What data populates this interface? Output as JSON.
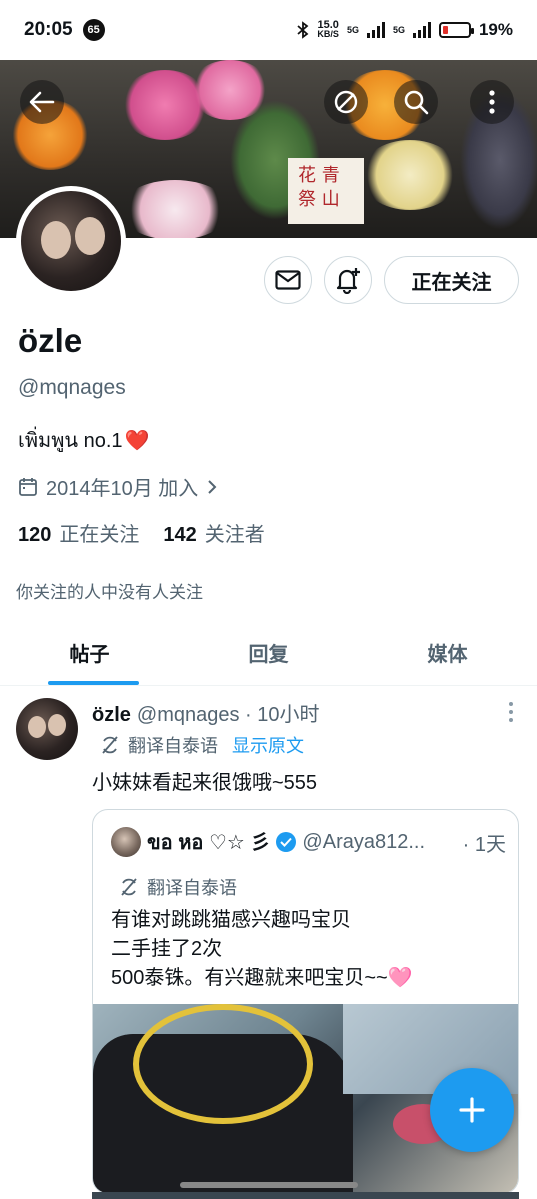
{
  "status_bar": {
    "time": "20:05",
    "notif_count": "65",
    "net_speed_value": "15.0",
    "net_speed_unit": "KB/S",
    "sim1": "5G",
    "sim2": "5G",
    "battery_percent": "19%",
    "battery_level": 0.19
  },
  "profile": {
    "display_name": "özle",
    "handle": "@mqnages",
    "bio": "เพิ่มพูน no.1",
    "bio_emoji": "❤️",
    "joined": "2014年10月 加入",
    "following_count": "120",
    "following_label": "正在关注",
    "followers_count": "142",
    "followers_label": "关注者",
    "mutual_note": "你关注的人中没有人关注",
    "follow_button": "正在关注"
  },
  "banner_sign": {
    "line1": "花 青",
    "line2": "祭 山"
  },
  "tabs": [
    {
      "label": "帖子",
      "active": true
    },
    {
      "label": "回复",
      "active": false
    },
    {
      "label": "媒体",
      "active": false
    }
  ],
  "post": {
    "name": "özle",
    "meta": "@mqnages · 10小时",
    "translate_label": "翻译自泰语",
    "show_original": "显示原文",
    "text": "小妹妹看起来很饿哦~555",
    "quote": {
      "name": "ขอ หอ ♡☆ 彡",
      "handle": "@Araya812...",
      "time": "· 1天",
      "translate_label": "翻译自泰语",
      "lines": [
        "有谁对跳跳猫感兴趣吗宝贝",
        "二手挂了2次",
        "500泰铢。有兴趣就来吧宝贝~~🩷"
      ]
    }
  },
  "colors": {
    "accent": "#1d9bf0",
    "text": "#0f1419",
    "muted": "#536471"
  }
}
